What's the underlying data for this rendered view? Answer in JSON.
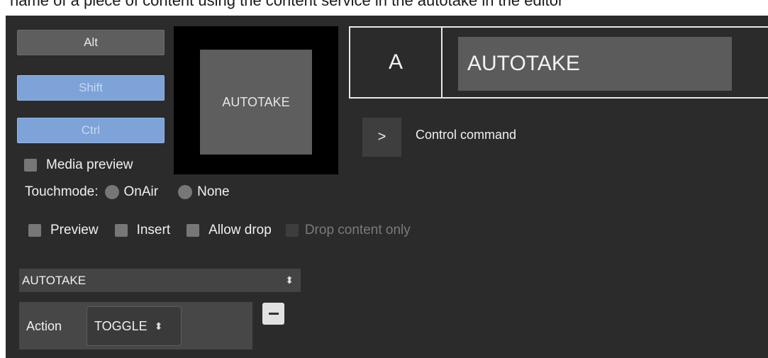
{
  "top_strip_text": "name of a piece of content using the content service in the autotake in the editor",
  "modifiers": {
    "alt": "Alt",
    "shift": "Shift",
    "ctrl": "Ctrl"
  },
  "media_preview_label": "Media preview",
  "preview_tile_label": "AUTOTAKE",
  "touchmode": {
    "label": "Touchmode:",
    "onair": "OnAir",
    "none": "None"
  },
  "options": {
    "preview": "Preview",
    "insert": "Insert",
    "allow_drop": "Allow drop",
    "drop_content_only": "Drop content only"
  },
  "key": {
    "letter": "A",
    "name": "AUTOTAKE"
  },
  "command": {
    "button": ">",
    "label": "Control command"
  },
  "command_select": {
    "value": "AUTOTAKE"
  },
  "action": {
    "label": "Action",
    "value": "TOGGLE"
  },
  "colors": {
    "panel": "#2b2b2b",
    "modifier_active": "#7da3d8",
    "modifier_inactive": "#5e5e5e"
  }
}
